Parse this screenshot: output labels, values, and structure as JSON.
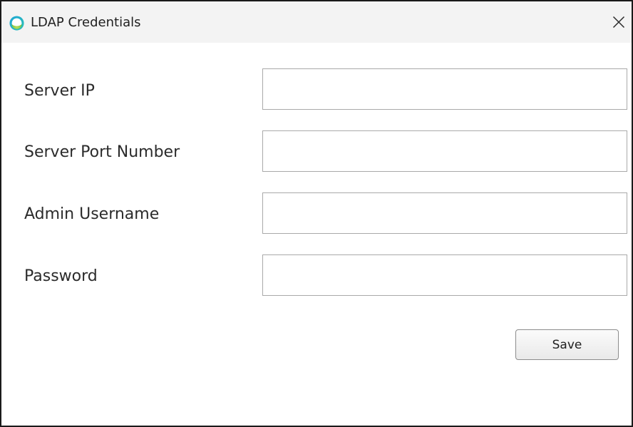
{
  "window": {
    "title": "LDAP Credentials",
    "app_icon": "ring-logo-icon",
    "close_icon": "close-icon"
  },
  "form": {
    "fields": [
      {
        "label": "Server IP",
        "value": "",
        "placeholder": ""
      },
      {
        "label": "Server Port Number",
        "value": "",
        "placeholder": ""
      },
      {
        "label": "Admin Username",
        "value": "",
        "placeholder": ""
      },
      {
        "label": "Password",
        "value": "",
        "placeholder": ""
      }
    ],
    "save_label": "Save"
  },
  "colors": {
    "titlebar_bg": "#f3f3f3",
    "border": "#a9a9a9",
    "icon_teal": "#27b5c9",
    "icon_green": "#9ad04a"
  }
}
